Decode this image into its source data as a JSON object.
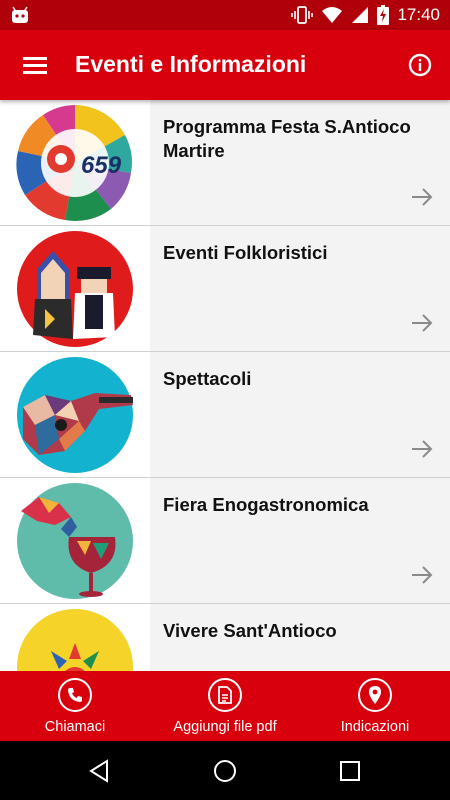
{
  "status_bar": {
    "time": "17:40",
    "icons": [
      "android-icon",
      "vibrate-icon",
      "wifi-icon",
      "signal-icon",
      "battery-charging-icon"
    ]
  },
  "app_bar": {
    "title": "Eventi e Informazioni",
    "menu_icon": "hamburger-menu-icon",
    "info_icon": "info-icon"
  },
  "list": {
    "items": [
      {
        "label": "Programma Festa S.Antioco Martire",
        "badge": "659",
        "image": "festa-logo"
      },
      {
        "label": "Eventi Folkloristici",
        "image": "folk-couple"
      },
      {
        "label": "Spettacoli",
        "image": "guitar"
      },
      {
        "label": "Fiera Enogastronomica",
        "image": "wine-glass"
      },
      {
        "label": "Vivere Sant'Antioco",
        "image": "sun-flower"
      }
    ]
  },
  "bottom_bar": {
    "call": "Chiamaci",
    "pdf": "Aggiungi file pdf",
    "directions": "Indicazioni"
  },
  "colors": {
    "primary": "#d9000d",
    "status_bar": "#b0000a",
    "list_bg": "#f3f3f3"
  }
}
